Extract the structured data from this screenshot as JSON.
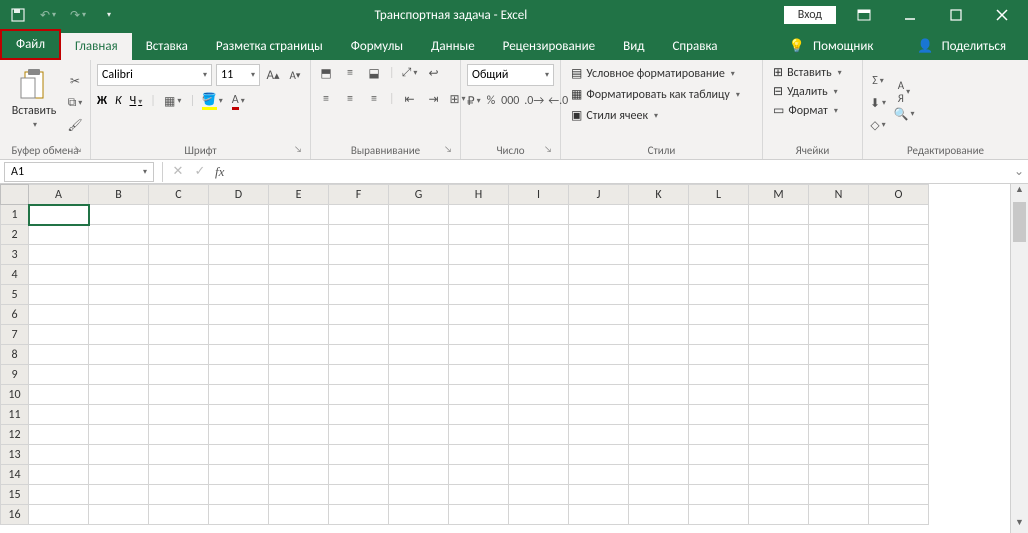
{
  "titlebar": {
    "doc_title": "Транспортная задача  -  Excel",
    "signin": "Вход"
  },
  "tabs": {
    "file": "Файл",
    "items": [
      "Главная",
      "Вставка",
      "Разметка страницы",
      "Формулы",
      "Данные",
      "Рецензирование",
      "Вид",
      "Справка"
    ],
    "tellme": "Помощник",
    "share": "Поделиться"
  },
  "ribbon": {
    "clipboard": {
      "paste": "Вставить",
      "label": "Буфер обмена"
    },
    "font": {
      "name": "Calibri",
      "size": "11",
      "label": "Шрифт",
      "bold": "Ж",
      "italic": "К",
      "underline": "Ч"
    },
    "alignment": {
      "label": "Выравнивание"
    },
    "number": {
      "format": "Общий",
      "label": "Число"
    },
    "styles": {
      "cond": "Условное форматирование",
      "table": "Форматировать как таблицу",
      "cell": "Стили ячеек",
      "label": "Стили"
    },
    "cells": {
      "insert": "Вставить",
      "delete": "Удалить",
      "format": "Формат",
      "label": "Ячейки"
    },
    "editing": {
      "label": "Редактирование"
    }
  },
  "namebox": "A1",
  "columns": [
    "A",
    "B",
    "C",
    "D",
    "E",
    "F",
    "G",
    "H",
    "I",
    "J",
    "K",
    "L",
    "M",
    "N",
    "O"
  ],
  "rows": [
    "1",
    "2",
    "3",
    "4",
    "5",
    "6",
    "7",
    "8",
    "9",
    "10",
    "11",
    "12",
    "13",
    "14",
    "15",
    "16"
  ]
}
